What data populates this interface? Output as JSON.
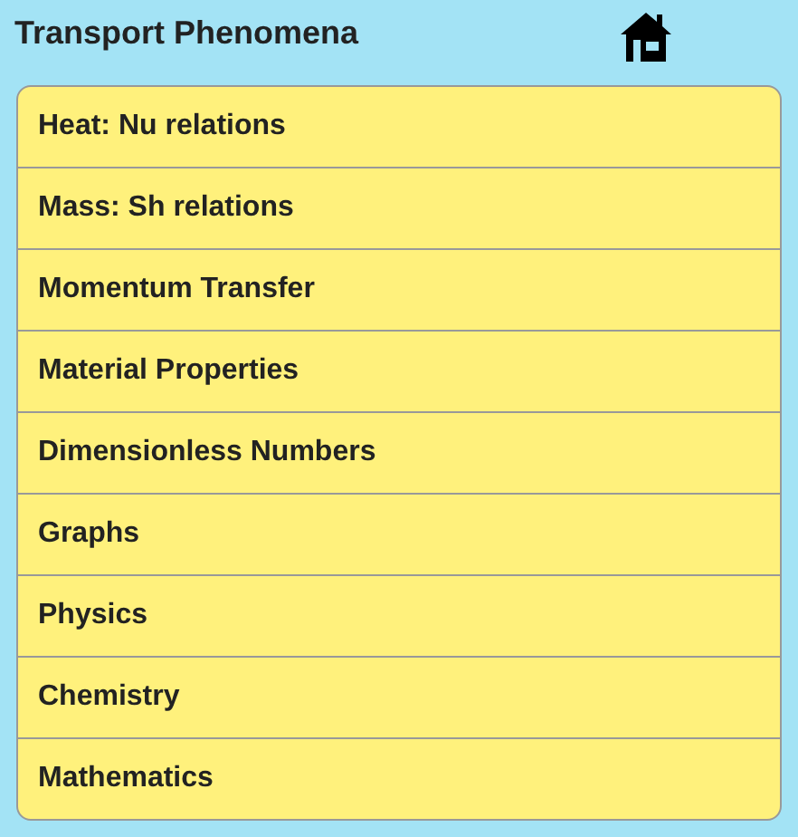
{
  "header": {
    "title": "Transport Phenomena"
  },
  "menu": [
    {
      "label": "Heat: Nu relations"
    },
    {
      "label": "Mass: Sh relations"
    },
    {
      "label": "Momentum Transfer"
    },
    {
      "label": "Material Properties"
    },
    {
      "label": "Dimensionless Numbers"
    },
    {
      "label": "Graphs"
    },
    {
      "label": "Physics"
    },
    {
      "label": "Chemistry"
    },
    {
      "label": "Mathematics"
    }
  ]
}
